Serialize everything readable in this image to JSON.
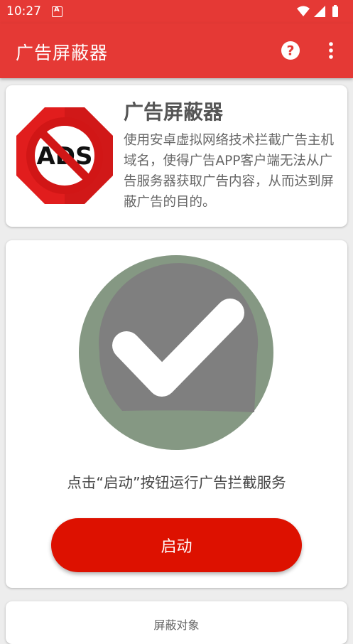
{
  "status_bar": {
    "time": "10:27",
    "notification_icon": "app-notification-icon"
  },
  "app_bar": {
    "title": "广告屏蔽器",
    "help_icon": "help-icon",
    "menu_icon": "more-vert-icon"
  },
  "intro_card": {
    "logo_icon": "ads-blocked-icon",
    "heading": "广告屏蔽器",
    "description": "使用安卓虚拟网络技术拦截广告主机域名，使得广告APP客户端无法从广告服务器获取广告内容，从而达到屏蔽广告的目的。"
  },
  "status_card": {
    "status_icon": "checkmark-icon",
    "hint": "点击“启动”按钮运行广告拦截服务",
    "start_label": "启动"
  },
  "targets_card": {
    "label": "屏蔽对象"
  },
  "colors": {
    "primary": "#e53935",
    "button": "#dd1100",
    "check_outer": "#859883",
    "check_inner": "#7f7f7f"
  }
}
